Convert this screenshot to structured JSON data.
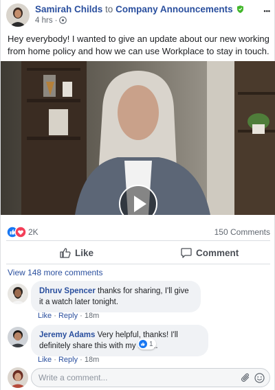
{
  "post": {
    "author": "Samirah Childs",
    "to_word": "to",
    "group": "Company Announcements",
    "time": "4 hrs",
    "dot": "·",
    "more_icon": "•••",
    "text": "Hey everybody! I wanted to give an update about our new working from home policy and how we can use Workplace to stay in touch."
  },
  "stats": {
    "reaction_count": "2K",
    "comment_count": "150 Comments"
  },
  "actions": {
    "like": "Like",
    "comment": "Comment"
  },
  "view_more": "View 148 more comments",
  "comments": [
    {
      "name": "Dhruv Spencer",
      "text": "thanks for sharing, I'll give it a watch later tonight.",
      "like": "Like",
      "reply": "Reply",
      "time": "18m"
    },
    {
      "name": "Jeremy Adams",
      "text": "Very helpful, thanks! I'll definitely share this with my team.",
      "like": "Like",
      "reply": "Reply",
      "time": "18m",
      "reaction_count": "1"
    }
  ],
  "composer": {
    "placeholder": "Write a comment..."
  },
  "colors": {
    "link": "#2a4f9e",
    "like_blue": "#1877f2",
    "love_red": "#f33e58",
    "group_badge": "#42b72a"
  }
}
